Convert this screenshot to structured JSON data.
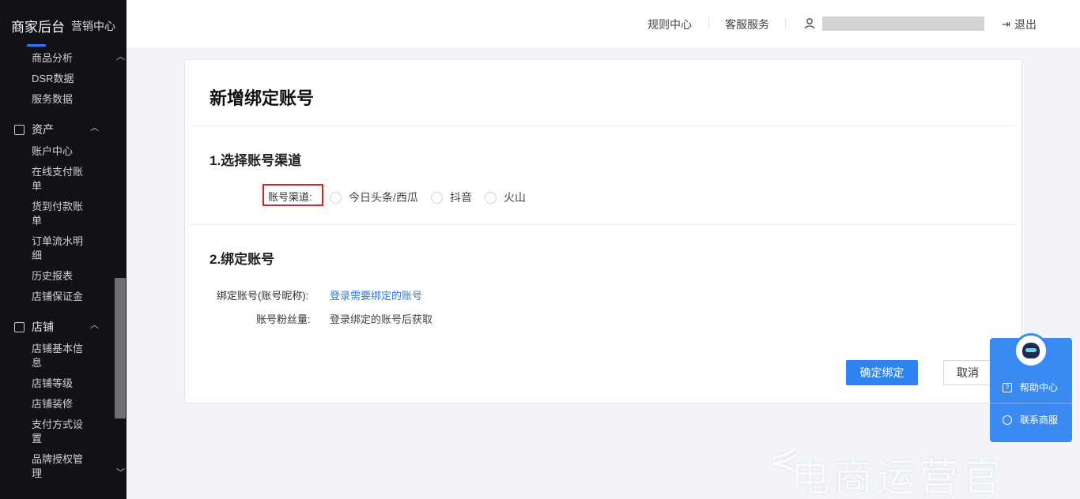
{
  "sidebar": {
    "title": "商家后台",
    "subtitle": "营销中心",
    "items_top": [
      "商品分析",
      "DSR数据",
      "服务数据"
    ],
    "section_assets": {
      "label": "资产",
      "items": [
        "账户中心",
        "在线支付账单",
        "货到付款账单",
        "订单流水明细",
        "历史报表",
        "店铺保证金"
      ]
    },
    "section_shop": {
      "label": "店铺",
      "items": [
        "店铺基本信息",
        "店铺等级",
        "店铺装修",
        "支付方式设置",
        "品牌授权管理"
      ]
    }
  },
  "topbar": {
    "rules": "规则中心",
    "service": "客服服务",
    "logout": "退出"
  },
  "card": {
    "title": "新增绑定账号",
    "step1": {
      "title": "1.选择账号渠道",
      "label": "账号渠道:",
      "options": [
        "今日头条/西瓜",
        "抖音",
        "火山"
      ]
    },
    "step2": {
      "title": "2.绑定账号",
      "account_label": "绑定账号(账号昵称):",
      "account_link": "登录需要绑定的账号",
      "fans_label": "账号粉丝量:",
      "fans_value": "登录绑定的账号后获取"
    },
    "confirm": "确定绑定",
    "cancel": "取消"
  },
  "help": {
    "help_center": "帮助中心",
    "contact": "联系商服"
  },
  "watermark": "电商运营官",
  "colors": {
    "primary": "#2f84f0",
    "sidebar_bg": "#111218",
    "highlight": "#e02020"
  }
}
